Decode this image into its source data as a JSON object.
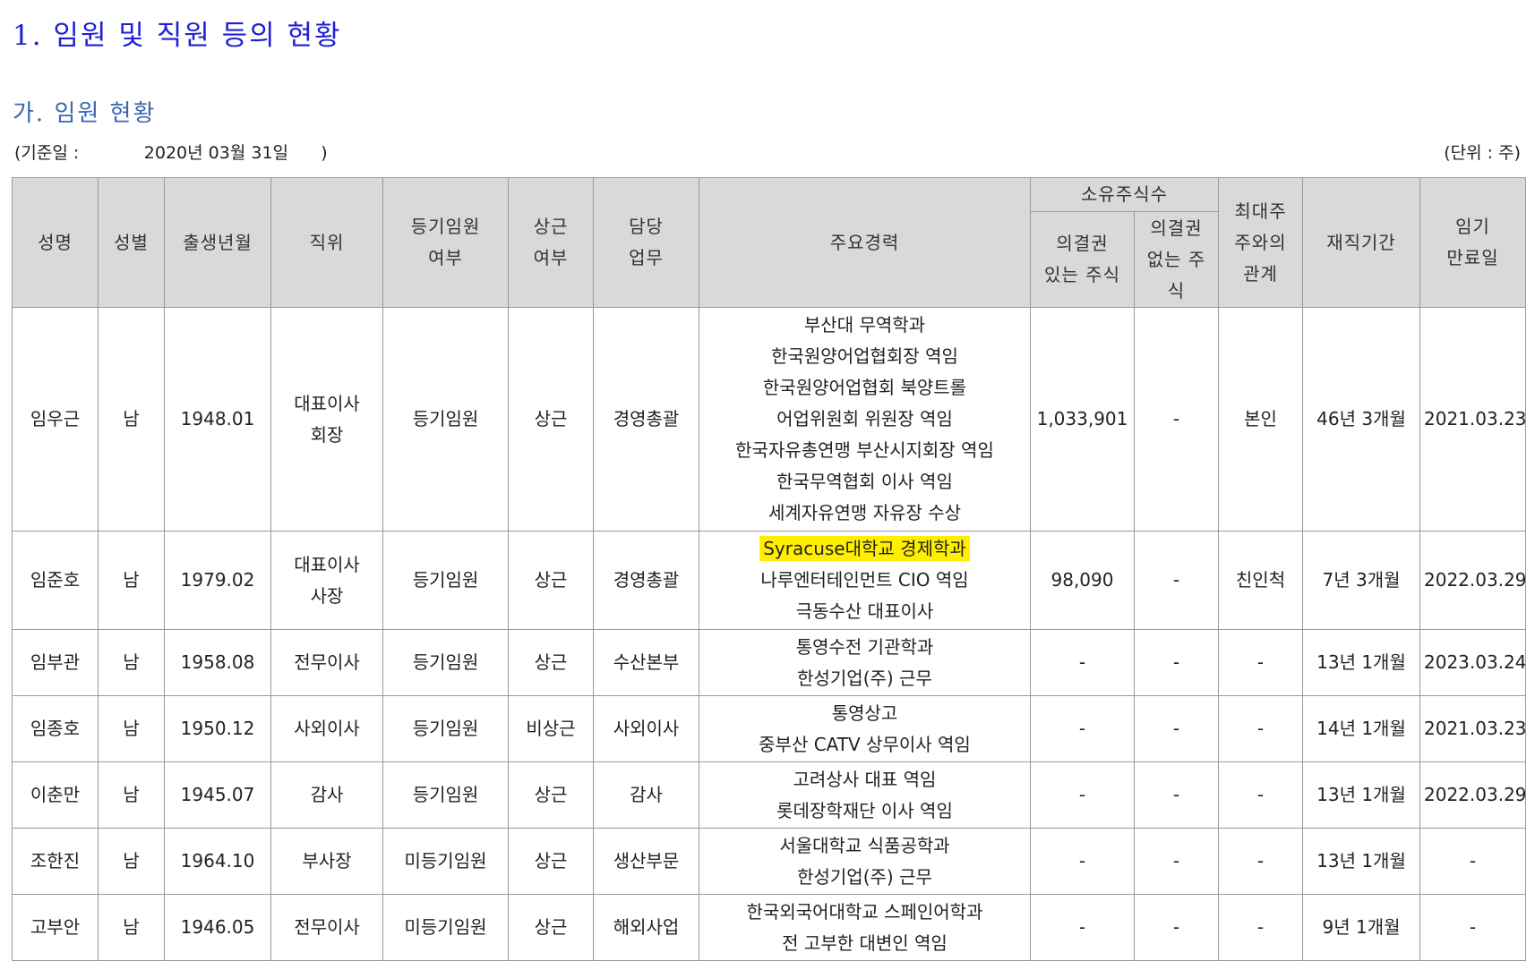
{
  "section_title": "1. 임원 및 직원 등의 현황",
  "sub_title": "가. 임원 현황",
  "base_date": {
    "label": "(기준일 :",
    "value": "2020년 03월 31일",
    "close": ")"
  },
  "unit": "(단위 : 주)",
  "headers": {
    "name": "성명",
    "gender": "성별",
    "birth": "출생년월",
    "position": "직위",
    "registered": [
      "등기임원",
      "여부"
    ],
    "fulltime": [
      "상근",
      "여부"
    ],
    "duty": [
      "담당",
      "업무"
    ],
    "career": "주요경력",
    "shares_group": "소유주식수",
    "voting": [
      "의결권",
      "있는 주식"
    ],
    "nonvoting": [
      "의결권",
      "없는 주",
      "식"
    ],
    "relation": [
      "최대주",
      "주와의",
      "관계"
    ],
    "tenure": "재직기간",
    "term": [
      "임기",
      "만료일"
    ]
  },
  "rows": [
    {
      "name": "임우근",
      "gender": "남",
      "birth": "1948.01",
      "position": [
        "대표이사",
        "회장"
      ],
      "registered": "등기임원",
      "fulltime": "상근",
      "duty": "경영총괄",
      "career": [
        "부산대 무역학과",
        "한국원양어업협회장 역임",
        "한국원양어업협회 북양트롤",
        "어업위원회 위원장 역임",
        "한국자유총연맹 부산시지회장 역임",
        "한국무역협회 이사 역임",
        "세계자유연맹 자유장 수상"
      ],
      "voting": "1,033,901",
      "nonvoting": "-",
      "relation": "본인",
      "tenure": "46년 3개월",
      "term": "2021.03.23"
    },
    {
      "name": "임준호",
      "gender": "남",
      "birth": "1979.02",
      "position": [
        "대표이사",
        "사장"
      ],
      "registered": "등기임원",
      "fulltime": "상근",
      "duty": "경영총괄",
      "career": [
        "Syracuse대학교 경제학과",
        "나루엔터테인먼트 CIO 역임",
        "극동수산 대표이사"
      ],
      "voting": "98,090",
      "nonvoting": "-",
      "relation": "친인척",
      "tenure": "7년 3개월",
      "term": "2022.03.29"
    },
    {
      "name": "임부관",
      "gender": "남",
      "birth": "1958.08",
      "position": [
        "전무이사"
      ],
      "registered": "등기임원",
      "fulltime": "상근",
      "duty": "수산본부",
      "career": [
        "통영수전 기관학과",
        "한성기업(주) 근무"
      ],
      "voting": "-",
      "nonvoting": "-",
      "relation": "-",
      "tenure": "13년 1개월",
      "term": "2023.03.24"
    },
    {
      "name": "임종호",
      "gender": "남",
      "birth": "1950.12",
      "position": [
        "사외이사"
      ],
      "registered": "등기임원",
      "fulltime": "비상근",
      "duty": "사외이사",
      "career": [
        "통영상고",
        "중부산 CATV 상무이사 역임"
      ],
      "voting": "-",
      "nonvoting": "-",
      "relation": "-",
      "tenure": "14년 1개월",
      "term": "2021.03.23"
    },
    {
      "name": "이춘만",
      "gender": "남",
      "birth": "1945.07",
      "position": [
        "감사"
      ],
      "registered": "등기임원",
      "fulltime": "상근",
      "duty": "감사",
      "career": [
        "고려상사 대표 역임",
        "롯데장학재단 이사 역임"
      ],
      "voting": "-",
      "nonvoting": "-",
      "relation": "-",
      "tenure": "13년 1개월",
      "term": "2022.03.29"
    },
    {
      "name": "조한진",
      "gender": "남",
      "birth": "1964.10",
      "position": [
        "부사장"
      ],
      "registered": "미등기임원",
      "fulltime": "상근",
      "duty": "생산부문",
      "career": [
        "서울대학교 식품공학과",
        "한성기업(주) 근무"
      ],
      "voting": "-",
      "nonvoting": "-",
      "relation": "-",
      "tenure": "13년 1개월",
      "term": "-"
    },
    {
      "name": "고부안",
      "gender": "남",
      "birth": "1946.05",
      "position": [
        "전무이사"
      ],
      "registered": "미등기임원",
      "fulltime": "상근",
      "duty": "해외사업",
      "career": [
        "한국외국어대학교 스페인어학과",
        "전 고부한 대변인 역임"
      ],
      "voting": "-",
      "nonvoting": "-",
      "relation": "-",
      "tenure": "9년 1개월",
      "term": "-"
    }
  ],
  "highlight": {
    "row_index": 1,
    "line_index": 0,
    "color": "#ffee00"
  },
  "colors": {
    "title": "#1f1fd6",
    "subtitle": "#3a67b0",
    "header_bg": "#d9d9d9",
    "border": "#9a9a9a"
  }
}
